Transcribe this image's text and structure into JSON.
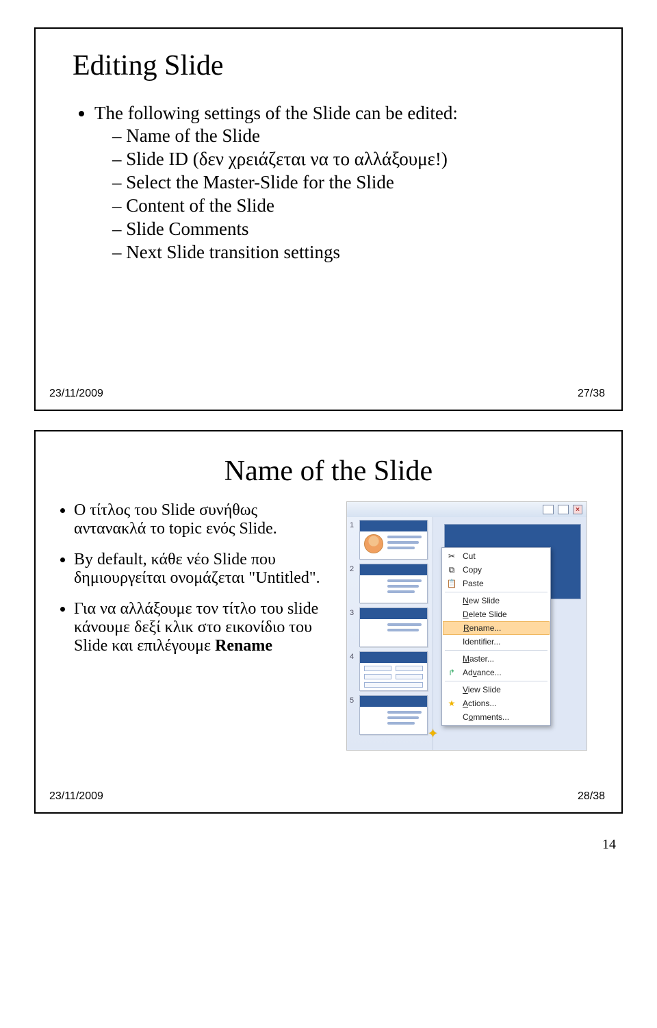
{
  "slide1": {
    "title": "Editing Slide",
    "lead": "The following settings of the Slide can be edited:",
    "items": [
      "Name of the Slide",
      "Slide ID (δεν χρειάζεται να το αλλάξουμε!)",
      "Select the Master-Slide for the Slide",
      "Content of the Slide",
      "Slide Comments",
      "Next Slide transition settings"
    ],
    "date": "23/11/2009",
    "page": "27/38"
  },
  "slide2": {
    "title": "Name of the Slide",
    "bullet1": "Ο τίτλος του Slide συνήθως αντανακλά το topic ενός Slide.",
    "bullet2_pre": "By default, κάθε νέο Slide που δημιουργείται ονομάζεται \"Untitled\".",
    "bullet3_pre": "Για να αλλάξουμε τον τίτλο του slide κάνουμε δεξί κλικ στο εικονίδιο του Slide και επιλέγουμε ",
    "bullet3_bold": "Rename",
    "date": "23/11/2009",
    "page": "28/38"
  },
  "context_menu": {
    "cut": "Cut",
    "copy": "Copy",
    "paste": "Paste",
    "new_slide": "New Slide",
    "delete_slide": "Delete Slide",
    "rename": "Rename...",
    "identifier": "Identifier...",
    "master": "Master...",
    "advance": "Advance...",
    "view_slide": "View Slide",
    "actions": "Actions...",
    "comments": "Comments..."
  },
  "thumbs": [
    "1",
    "2",
    "3",
    "4",
    "5"
  ],
  "doc_page": "14"
}
